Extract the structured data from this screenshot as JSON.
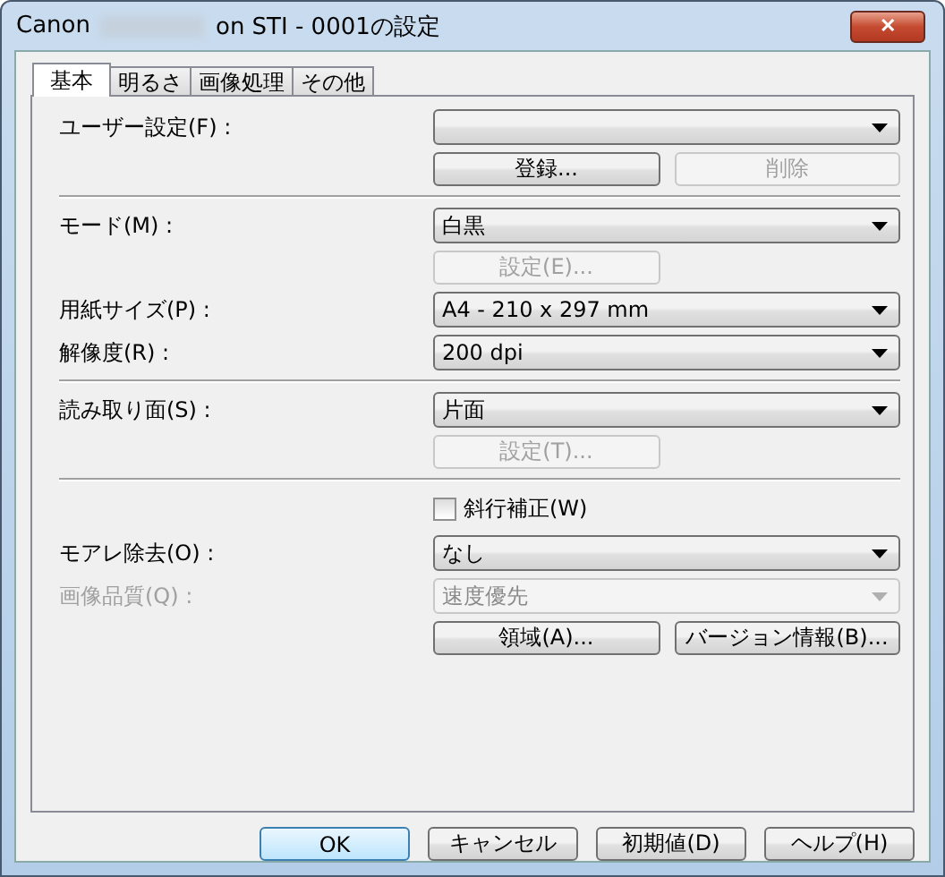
{
  "window": {
    "title_start": "Canon",
    "title_end": "on STI - 0001の設定",
    "close": "✕"
  },
  "tabs": [
    {
      "label": "基本",
      "selected": true
    },
    {
      "label": "明るさ",
      "selected": false
    },
    {
      "label": "画像処理",
      "selected": false
    },
    {
      "label": "その他",
      "selected": false
    }
  ],
  "rows": [
    {
      "kind": "combo",
      "label": "ユーザー設定(F) :",
      "disabled": false
    },
    {
      "kind": "buttons",
      "buttons": [
        {
          "label": "登録...",
          "disabled": false
        },
        {
          "label": "削除",
          "disabled": true
        }
      ]
    },
    {
      "kind": "divider"
    },
    {
      "kind": "combo",
      "label": "モード(M) :",
      "value": "白黒",
      "disabled": false
    },
    {
      "kind": "buttons",
      "buttons": [
        {
          "label": "設定(E)...",
          "disabled": true
        }
      ]
    },
    {
      "kind": "combo",
      "label": "用紙サイズ(P) :",
      "value": "A4 - 210 x 297 mm",
      "disabled": false
    },
    {
      "kind": "combo",
      "label": "解像度(R) :",
      "value": "200 dpi",
      "disabled": false
    },
    {
      "kind": "divider"
    },
    {
      "kind": "combo",
      "label": "読み取り面(S) :",
      "value": "片面",
      "disabled": false
    },
    {
      "kind": "buttons",
      "buttons": [
        {
          "label": "設定(T)...",
          "disabled": true
        }
      ]
    },
    {
      "kind": "divider"
    },
    {
      "kind": "checkbox",
      "label": "斜行補正(W)",
      "checked": false
    },
    {
      "kind": "combo",
      "label": "モアレ除去(O) :",
      "value": "なし",
      "disabled": false
    },
    {
      "kind": "combo",
      "label": "画像品質(Q) :",
      "value": "速度優先",
      "disabled": true
    },
    {
      "kind": "buttons",
      "buttons": [
        {
          "label": "領域(A)...",
          "disabled": false
        },
        {
          "label": "バージョン情報(B)...",
          "disabled": false
        }
      ]
    }
  ],
  "footer": [
    {
      "label": "OK",
      "default": true
    },
    {
      "label": "キャンセル",
      "default": false
    },
    {
      "label": "初期値(D)",
      "default": false
    },
    {
      "label": "ヘルプ(H)",
      "default": false
    }
  ]
}
